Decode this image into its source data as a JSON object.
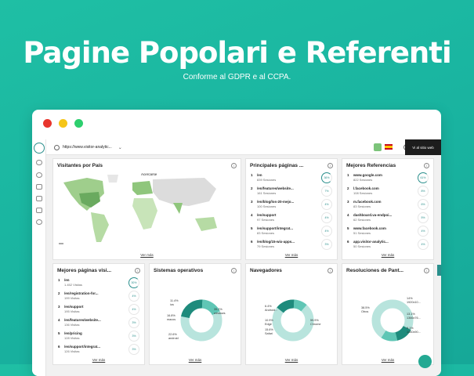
{
  "hero": {
    "title": "Pagine Popolari e Referenti",
    "subtitle": "Conforme al GDPR e al CCPA."
  },
  "window": {
    "dot_colors": [
      "#e8352d",
      "#f5c518",
      "#2dcf6e"
    ]
  },
  "topbar": {
    "url": "https://www.visitor-analytic...",
    "site_button": "Vi al sitio web"
  },
  "map_card": {
    "title": "Visitantes por País",
    "tooltip": "Acercarse",
    "more": "Ver más"
  },
  "pages_card": {
    "title": "Principales páginas ...",
    "more": "Ver más",
    "rows": [
      {
        "n": "1",
        "path": "/en",
        "sessions": "839 Sesiones",
        "pct": "36%"
      },
      {
        "n": "2",
        "path": "/en/features/website...",
        "sessions": "161 Sesiones",
        "pct": "7%"
      },
      {
        "n": "3",
        "path": "/en/blog/los-20-mejo...",
        "sessions": "100 Sesiones",
        "pct": "4%"
      },
      {
        "n": "4",
        "path": "/en/support",
        "sessions": "97 Sesiones",
        "pct": "4%"
      },
      {
        "n": "5",
        "path": "/en/support/integrat...",
        "sessions": "83 Sesiones",
        "pct": "4%"
      },
      {
        "n": "6",
        "path": "/en/blog/15-wix-apps...",
        "sessions": "79 Sesiones",
        "pct": "3%"
      }
    ]
  },
  "ref_card": {
    "title": "Mejores Referencias",
    "more": "Ver más",
    "rows": [
      {
        "n": "1",
        "path": "www.google.com",
        "sessions": "822 Sesiones",
        "pct": "61%"
      },
      {
        "n": "2",
        "path": "l.facebook.com",
        "sessions": "108 Sesiones",
        "pct": "8%"
      },
      {
        "n": "3",
        "path": "m.facebook.com",
        "sessions": "83 Sesiones",
        "pct": "6%"
      },
      {
        "n": "4",
        "path": "dashboard.va-endpoi...",
        "sessions": "62 Sesiones",
        "pct": "5%"
      },
      {
        "n": "5",
        "path": "www.facebook.com",
        "sessions": "51 Sesiones",
        "pct": "4%"
      },
      {
        "n": "6",
        "path": "app.visitor-analytic...",
        "sessions": "50 Sesiones",
        "pct": "4%"
      }
    ]
  },
  "visits_card": {
    "title": "Mejores páginas visi...",
    "more": "Ver más",
    "rows": [
      {
        "n": "1",
        "path": "/en",
        "sessions": "1.452 Visitas",
        "pct": "30%"
      },
      {
        "n": "2",
        "path": "/en/registration-for...",
        "sessions": "199 Visitas",
        "pct": "4%"
      },
      {
        "n": "3",
        "path": "/en/support",
        "sessions": "195 Visitas",
        "pct": "4%"
      },
      {
        "n": "4",
        "path": "/en/features/website...",
        "sessions": "136 Visitas",
        "pct": "3%"
      },
      {
        "n": "5",
        "path": "/en/pricing",
        "sessions": "128 Visitas",
        "pct": "3%"
      },
      {
        "n": "6",
        "path": "/en/support/integrat...",
        "sessions": "126 Visitas",
        "pct": "3%"
      }
    ]
  },
  "os_card": {
    "title": "Sistemas operativos",
    "more": "Ver más",
    "labels": [
      {
        "t": "11.4%\nios"
      },
      {
        "t": "16.8%\nmacos"
      },
      {
        "t": "22.6%\nandroid"
      },
      {
        "t": "39.2%\nwindows"
      }
    ]
  },
  "browser_card": {
    "title": "Navegadores",
    "more": "Ver más",
    "labels": [
      {
        "t": "6.4%\nAndroid..."
      },
      {
        "t": "10.9%\nEdge"
      },
      {
        "t": "15.6%\nSafari"
      },
      {
        "t": "59.9%\nChrome"
      }
    ]
  },
  "res_card": {
    "title": "Resoluciones de Pant...",
    "more": "Ver más",
    "labels": [
      {
        "t": "38.5%\nOtros"
      },
      {
        "t": "14%\n1920x10..."
      },
      {
        "t": "13.1%\n1366x76..."
      },
      {
        "t": "9.1%\n1440x90..."
      }
    ]
  }
}
